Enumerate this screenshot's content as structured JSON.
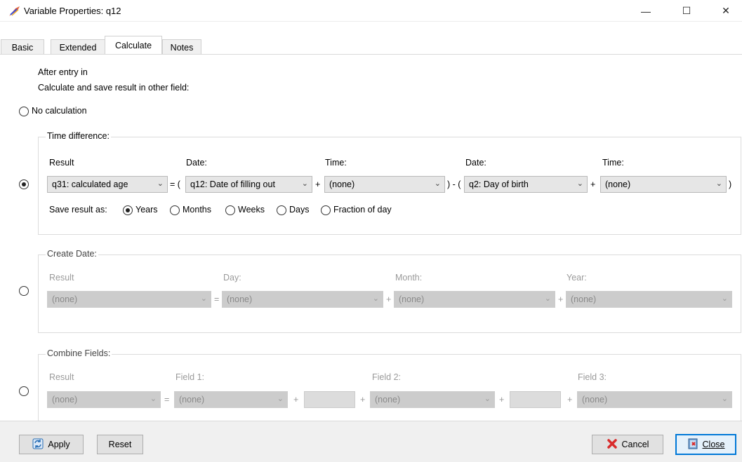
{
  "window": {
    "title": "Variable Properties: q12",
    "controls": {
      "minimize": "—",
      "maximize": "☐",
      "close": "✕"
    }
  },
  "tabs": [
    {
      "label": "Basic",
      "active": false
    },
    {
      "label": "Extended",
      "active": false
    },
    {
      "label": "Calculate",
      "active": true
    },
    {
      "label": "Notes",
      "active": false
    }
  ],
  "intro": {
    "line1": "After entry in",
    "line2": "Calculate and save result in other field:"
  },
  "no_calc": {
    "label": "No calculation",
    "selected": false
  },
  "time_difference": {
    "legend": "Time difference:",
    "selected": true,
    "labels": {
      "result": "Result",
      "date1": "Date:",
      "time1": "Time:",
      "date2": "Date:",
      "time2": "Time:"
    },
    "values": {
      "result": "q31: calculated age",
      "date1": "q12: Date of filling out",
      "time1": "(none)",
      "date2": "q2: Day of birth",
      "time2": "(none)"
    },
    "ops": {
      "eq_open": "= (",
      "plus1": "+",
      "close_minus_open": ") - (",
      "plus2": "+",
      "close": ")"
    },
    "save_as": {
      "label": "Save result as:",
      "options": [
        {
          "label": "Years",
          "selected": true
        },
        {
          "label": "Months",
          "selected": false
        },
        {
          "label": "Weeks",
          "selected": false
        },
        {
          "label": "Days",
          "selected": false
        },
        {
          "label": "Fraction of day",
          "selected": false
        }
      ]
    }
  },
  "create_date": {
    "legend": "Create Date:",
    "selected": false,
    "labels": {
      "result": "Result",
      "day": "Day:",
      "month": "Month:",
      "year": "Year:"
    },
    "values": {
      "result": "(none)",
      "day": "(none)",
      "month": "(none)",
      "year": "(none)"
    },
    "ops": {
      "eq": "=",
      "plus1": "+",
      "plus2": "+"
    }
  },
  "combine_fields": {
    "legend": "Combine Fields:",
    "selected": false,
    "labels": {
      "result": "Result",
      "field1": "Field 1:",
      "field2": "Field 2:",
      "field3": "Field 3:"
    },
    "values": {
      "result": "(none)",
      "field1": "(none)",
      "sep1": "",
      "field2": "(none)",
      "sep2": "",
      "field3": "(none)"
    },
    "ops": {
      "eq": "=",
      "plus1": "+",
      "plus2": "+",
      "plus3": "+",
      "plus4": "+"
    }
  },
  "footer": {
    "apply": "Apply",
    "reset": "Reset",
    "cancel": "Cancel",
    "close": "Close"
  },
  "colors": {
    "accent": "#0078d7",
    "cancel_icon": "#d92b2b",
    "apply_icon": "#2a6fb5"
  }
}
